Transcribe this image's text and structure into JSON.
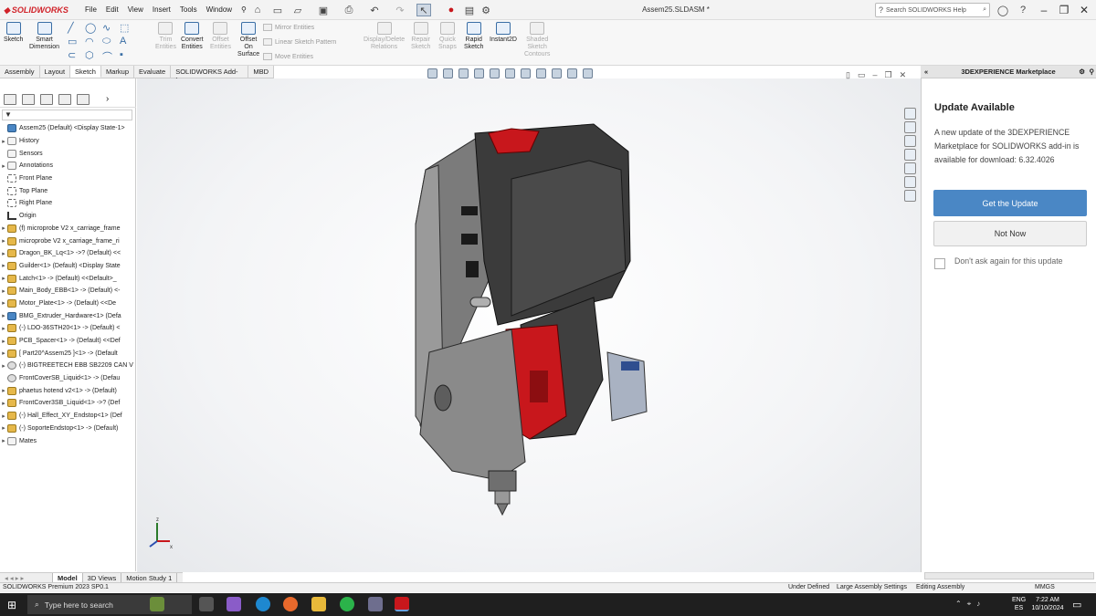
{
  "app": {
    "logo_text": "SOLIDWORKS",
    "document_title": "Assem25.SLDASM *",
    "menus": [
      "File",
      "Edit",
      "View",
      "Insert",
      "Tools",
      "Window"
    ],
    "help_search_placeholder": "Search SOLIDWORKS Help"
  },
  "ribbon": {
    "sketch": "Sketch",
    "smart_dimension_1": "Smart",
    "smart_dimension_2": "Dimension",
    "trim_1": "Trim",
    "trim_2": "Entities",
    "convert_1": "Convert",
    "convert_2": "Entities",
    "offset_1": "Offset",
    "offset_2": "Entities",
    "offset_surface_1": "Offset",
    "offset_surface_2": "On",
    "offset_surface_3": "Surface",
    "mirror": "Mirror Entities",
    "linear_pattern": "Linear Sketch Pattern",
    "move": "Move Entities",
    "display_delete_1": "Display/Delete",
    "display_delete_2": "Relations",
    "repair_1": "Repair",
    "repair_2": "Sketch",
    "quick_snaps_1": "Quick",
    "quick_snaps_2": "Snaps",
    "rapid_1": "Rapid",
    "rapid_2": "Sketch",
    "instant2d": "Instant2D",
    "shaded_1": "Shaded",
    "shaded_2": "Sketch",
    "shaded_3": "Contours"
  },
  "command_tabs": [
    "Assembly",
    "Layout",
    "Sketch",
    "Markup",
    "Evaluate",
    "SOLIDWORKS Add-Ins",
    "MBD"
  ],
  "active_command_tab": "Sketch",
  "feature_tree": {
    "root": "Assem25 (Default) <Display State-1>",
    "items": [
      {
        "label": "History",
        "icon": "folder",
        "exp": "▸"
      },
      {
        "label": "Sensors",
        "icon": "folder",
        "exp": ""
      },
      {
        "label": "Annotations",
        "icon": "folder",
        "exp": "▸"
      },
      {
        "label": "Front Plane",
        "icon": "plane",
        "exp": ""
      },
      {
        "label": "Top Plane",
        "icon": "plane",
        "exp": ""
      },
      {
        "label": "Right Plane",
        "icon": "plane",
        "exp": ""
      },
      {
        "label": "Origin",
        "icon": "origin",
        "exp": ""
      },
      {
        "label": "(f) microprobe V2 x_carriage_frame",
        "icon": "part",
        "exp": "▸"
      },
      {
        "label": "microprobe V2 x_carriage_frame_ri",
        "icon": "part",
        "exp": "▸"
      },
      {
        "label": "Dragon_BK_Lq<1> ->? (Default) <<",
        "icon": "part",
        "exp": "▸"
      },
      {
        "label": "Guilder<1> (Default) <Display State",
        "icon": "part",
        "exp": "▸"
      },
      {
        "label": "Latch<1> -> (Default) <<Default>_",
        "icon": "part",
        "exp": "▸"
      },
      {
        "label": "Main_Body_EBB<1> -> (Default) <-",
        "icon": "part",
        "exp": "▸"
      },
      {
        "label": "Motor_Plate<1> -> (Default) <<De",
        "icon": "part",
        "exp": "▸"
      },
      {
        "label": "BMG_Extruder_Hardware<1> (Defa",
        "icon": "asm",
        "exp": "▸"
      },
      {
        "label": "(-) LDO-36STH20<1> -> (Default) <",
        "icon": "part",
        "exp": "▸"
      },
      {
        "label": "PCB_Spacer<1> -> (Default) <<Def",
        "icon": "part",
        "exp": "▸"
      },
      {
        "label": "[ Part20^Assem25 ]<1> -> (Default",
        "icon": "part",
        "exp": "▸"
      },
      {
        "label": "(-) BIGTREETECH EBB SB2209 CAN V",
        "icon": "gear",
        "exp": "▸"
      },
      {
        "label": "FrontCoverSB_Liquid<1> -> (Defau",
        "icon": "gear",
        "exp": ""
      },
      {
        "label": "phaetus hotend v2<1> -> (Default)",
        "icon": "part",
        "exp": "▸"
      },
      {
        "label": "FrontCover3SB_Liquid<1> ->? (Def",
        "icon": "part",
        "exp": "▸"
      },
      {
        "label": "(-) Hall_Effect_XY_Endstop<1> (Def",
        "icon": "part",
        "exp": "▸"
      },
      {
        "label": "(-) SoporteEndstop<1> -> (Default)",
        "icon": "part",
        "exp": "▸"
      },
      {
        "label": "Mates",
        "icon": "folder",
        "exp": "▸"
      }
    ],
    "filter_symbol": "▼"
  },
  "bottom_tabs": [
    "Model",
    "3D Views",
    "Motion Study 1"
  ],
  "task_pane": {
    "title": "3DEXPERIENCE Marketplace",
    "update_title": "Update Available",
    "update_text": "A new update of the 3DEXPERIENCE Marketplace for SOLIDWORKS add-in is available for download: 6.32.4026",
    "get_update": "Get the Update",
    "not_now": "Not Now",
    "dont_ask": "Don't ask again for this update"
  },
  "status_bar": {
    "version": "SOLIDWORKS Premium 2023 SP0.1",
    "state": "Under Defined",
    "settings": "Large Assembly Settings",
    "mode": "Editing Assembly",
    "units": "MMGS"
  },
  "taskbar": {
    "search_placeholder": "Type here to search",
    "lang_1": "ENG",
    "lang_2": "ES",
    "time": "7:22 AM",
    "date": "10/10/2024"
  },
  "triad": {
    "z": "z",
    "x": "x"
  },
  "colors": {
    "accent": "#4a87c5",
    "brand_red": "#d1232a",
    "part_red": "#c8171c"
  }
}
